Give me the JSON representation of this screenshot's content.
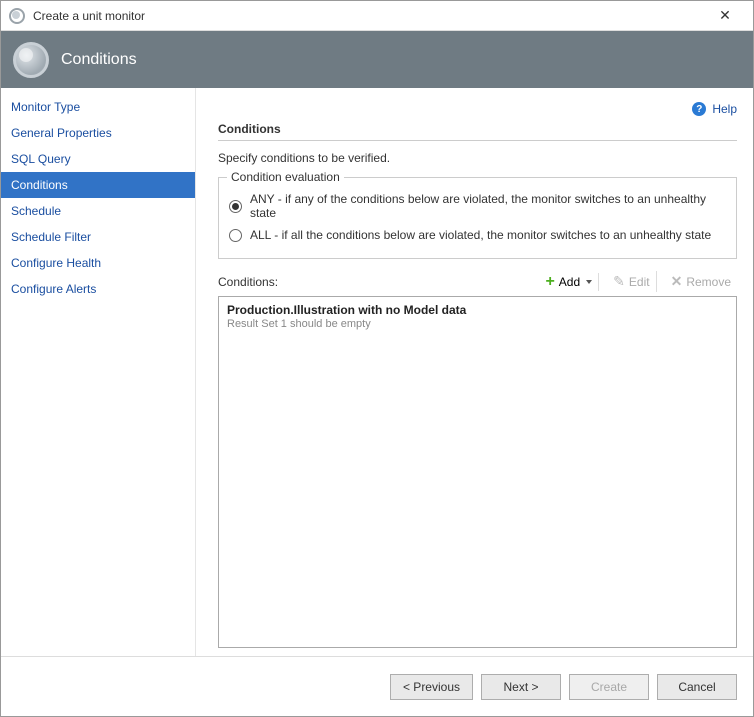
{
  "window": {
    "title": "Create a unit monitor",
    "banner_title": "Conditions",
    "close_glyph": "✕"
  },
  "sidebar": {
    "items": [
      {
        "label": "Monitor Type",
        "active": false
      },
      {
        "label": "General Properties",
        "active": false
      },
      {
        "label": "SQL Query",
        "active": false
      },
      {
        "label": "Conditions",
        "active": true
      },
      {
        "label": "Schedule",
        "active": false
      },
      {
        "label": "Schedule Filter",
        "active": false
      },
      {
        "label": "Configure Health",
        "active": false
      },
      {
        "label": "Configure Alerts",
        "active": false
      }
    ]
  },
  "help": {
    "label": "Help",
    "glyph": "?"
  },
  "content": {
    "section_title": "Conditions",
    "instruction": "Specify conditions to be verified.",
    "eval_group_title": "Condition evaluation",
    "radio_any": "ANY - if any of the conditions below are violated, the monitor switches to an unhealthy state",
    "radio_all": "ALL - if all the conditions below are violated, the monitor switches to an unhealthy state",
    "radio_selected": "any",
    "conditions_label": "Conditions:",
    "toolbar": {
      "add": "Add",
      "edit": "Edit",
      "remove": "Remove"
    },
    "conditions_list": [
      {
        "title": "Production.Illustration with no Model data",
        "subtitle": "Result Set 1 should be empty"
      }
    ]
  },
  "footer": {
    "previous": "< Previous",
    "next": "Next >",
    "create": "Create",
    "cancel": "Cancel"
  }
}
